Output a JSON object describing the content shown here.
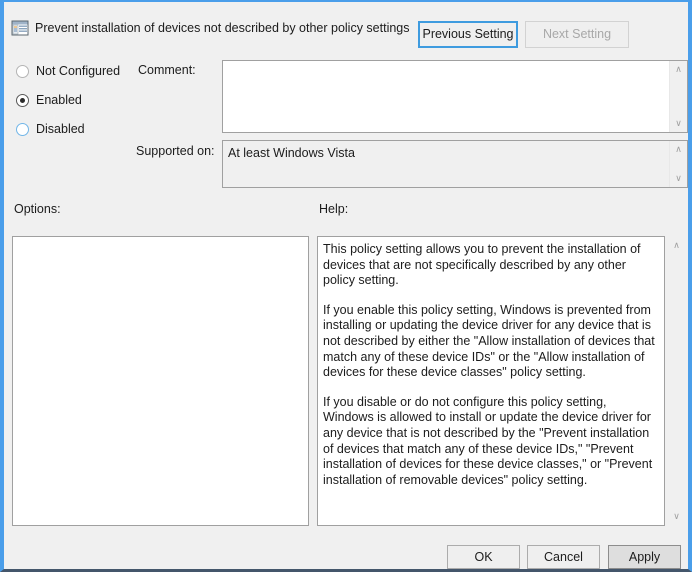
{
  "window": {
    "accent_color": "#4a9eea",
    "background_color": "#f0f0f0",
    "bottom_border_color": "#44566b"
  },
  "header": {
    "icon": "group-policy-setting-icon",
    "title": "Prevent installation of devices not described by other policy settings",
    "previous_setting_label": "Previous Setting",
    "next_setting_label": "Next Setting",
    "next_setting_disabled": true,
    "previous_setting_focused": true
  },
  "state_options": {
    "selected": "Enabled",
    "items": [
      {
        "label": "Not Configured",
        "checked": false,
        "hover": false
      },
      {
        "label": "Enabled",
        "checked": true,
        "hover": false
      },
      {
        "label": "Disabled",
        "checked": false,
        "hover": true
      }
    ]
  },
  "comment": {
    "label": "Comment:",
    "value": "",
    "placeholder": ""
  },
  "supported_on": {
    "label": "Supported on:",
    "value": "At least Windows Vista"
  },
  "options": {
    "label": "Options:",
    "content": ""
  },
  "help": {
    "label": "Help:",
    "paragraphs": [
      "This policy setting allows you to prevent the installation of devices that are not specifically described by any other policy setting.",
      "If you enable this policy setting, Windows is prevented from installing or updating the device driver for any device that is not described by either the \"Allow installation of devices that match any of these device IDs\" or the \"Allow installation of devices for these device classes\" policy setting.",
      "If you disable or do not configure this policy setting, Windows is allowed to install or update the device driver for any device that is not described by the \"Prevent installation of devices that match any of these device IDs,\" \"Prevent installation of devices for these device classes,\" or \"Prevent installation of removable devices\" policy setting."
    ]
  },
  "scrollbar": {
    "up_arrow": "∧",
    "down_arrow": "∨"
  },
  "footer": {
    "ok_label": "OK",
    "cancel_label": "Cancel",
    "apply_label": "Apply",
    "apply_highlighted": true
  }
}
